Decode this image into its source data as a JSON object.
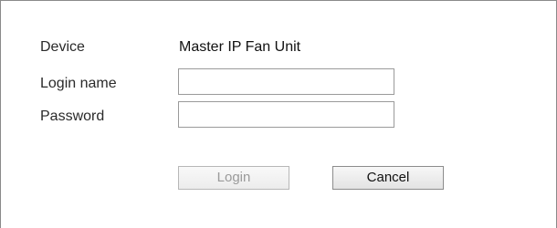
{
  "form": {
    "device_label": "Device",
    "device_value": "Master IP Fan Unit",
    "login_label": "Login name",
    "login_value": "",
    "password_label": "Password",
    "password_value": ""
  },
  "buttons": {
    "login_label": "Login",
    "login_enabled": false,
    "cancel_label": "Cancel"
  }
}
